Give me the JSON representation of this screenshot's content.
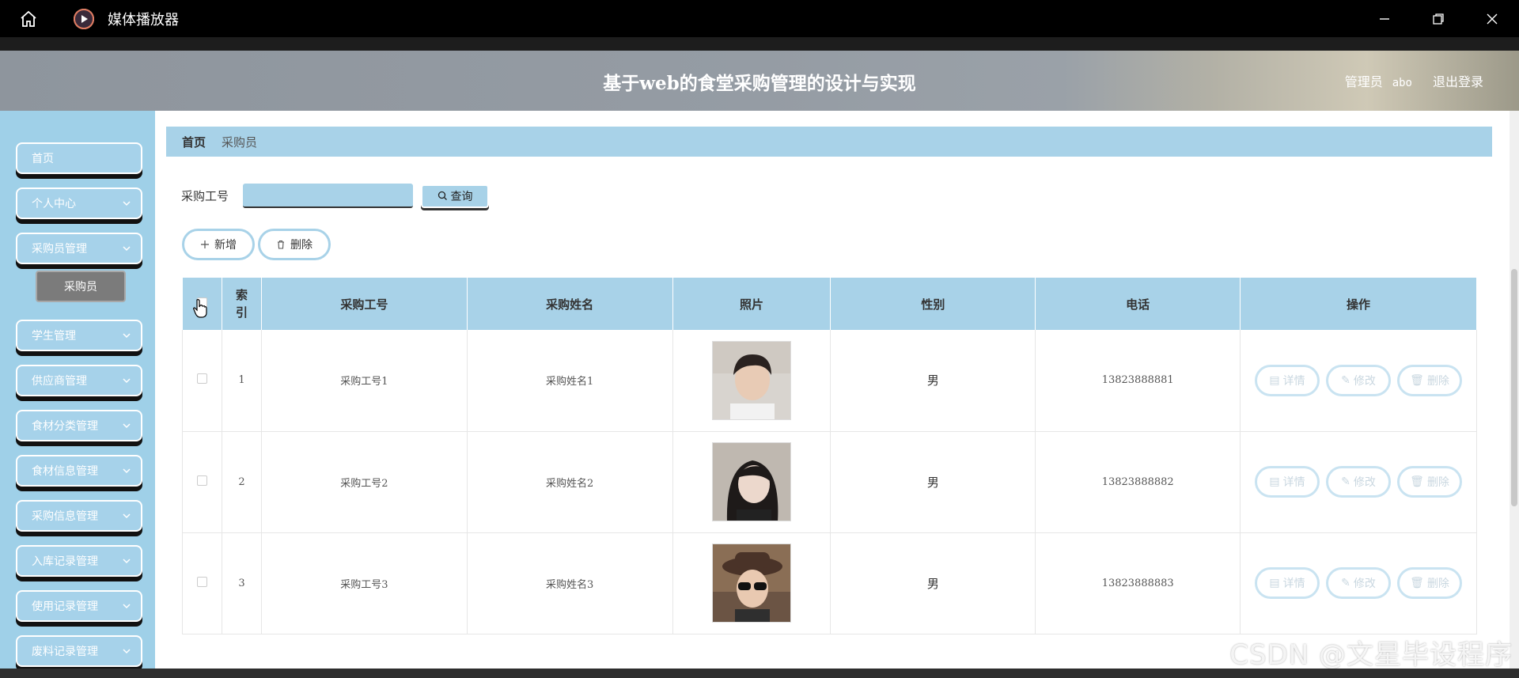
{
  "window": {
    "title": "媒体播放器"
  },
  "header": {
    "title": "基于web的食堂采购管理的设计与实现",
    "role": "管理员",
    "username": "abo",
    "logout": "退出登录"
  },
  "sidebar": {
    "items": [
      {
        "label": "首页"
      },
      {
        "label": "个人中心"
      },
      {
        "label": "采购员管理"
      },
      {
        "label": "学生管理"
      },
      {
        "label": "供应商管理"
      },
      {
        "label": "食材分类管理"
      },
      {
        "label": "食材信息管理"
      },
      {
        "label": "采购信息管理"
      },
      {
        "label": "入库记录管理"
      },
      {
        "label": "使用记录管理"
      },
      {
        "label": "废料记录管理"
      }
    ],
    "sub_item": "采购员"
  },
  "breadcrumb": {
    "home": "首页",
    "current": "采购员"
  },
  "search": {
    "label": "采购工号",
    "value": "",
    "button": "查询"
  },
  "actions": {
    "add": "新增",
    "delete": "删除"
  },
  "table": {
    "headers": {
      "index": "索引",
      "worker_no": "采购工号",
      "name": "采购姓名",
      "photo": "照片",
      "gender": "性别",
      "phone": "电话",
      "ops": "操作"
    },
    "op_labels": {
      "detail": "详情",
      "edit": "修改",
      "delete": "删除"
    },
    "rows": [
      {
        "index": "1",
        "worker_no": "采购工号1",
        "name": "采购姓名1",
        "gender": "男",
        "phone": "13823888881"
      },
      {
        "index": "2",
        "worker_no": "采购工号2",
        "name": "采购姓名2",
        "gender": "男",
        "phone": "13823888882"
      },
      {
        "index": "3",
        "worker_no": "采购工号3",
        "name": "采购姓名3",
        "gender": "男",
        "phone": "13823888883"
      }
    ]
  },
  "watermark": "CSDN @文星毕设程序",
  "colors": {
    "accent": "#a8d2e8",
    "sidebar": "#9fd0e8",
    "titlebar": "#000000"
  }
}
